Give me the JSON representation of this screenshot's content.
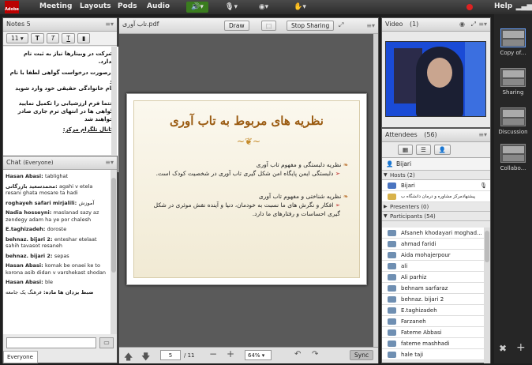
{
  "topbar": {
    "logo": "Adobe",
    "menus": [
      "Meeting",
      "Layouts",
      "Pods",
      "Audio"
    ],
    "help": "Help"
  },
  "notes": {
    "title": "Notes",
    "count": "5",
    "fontsize": "11",
    "lines": [
      "شرکت در وبینارها نیاز به ثبت نام ندارد.",
      "درصورت درخواست گواهی لطفا با نام و",
      "نام خانوادگی حقیقی خود وارد شوید",
      "حتما فرم ارزشیابی را تکمیل نمایید",
      "گواهی ها در انتهای ترم جاری صادر خواهند شد",
      "کانال تلگرام مرکز:"
    ]
  },
  "chat": {
    "title": "Chat",
    "scope": "(Everyone)",
    "footer": "Everyone",
    "messages": [
      {
        "who": "Hasan Abasi",
        "text": "tablighat"
      },
      {
        "who": "محمدسعید بازرگانی",
        "text": "agahi v etela resani ghata mosare ta hadi"
      },
      {
        "who": "roghayeh safari mirjalili",
        "text": "آموزش"
      },
      {
        "who": "Nadia hosseyni",
        "text": "maslanad sazy az zendegy adam ha ye por chalesh"
      },
      {
        "who": "E.taghizadeh",
        "text": "doroste"
      },
      {
        "who": "behnaz. bijari 2",
        "text": "enteshar etelaat sahih tavasot resaneh"
      },
      {
        "who": "behnaz. bijari 2",
        "text": "sepas"
      },
      {
        "who": "Hasan Abasi",
        "text": "komak be onaei ke to korona asib didan v varshekast shodan"
      },
      {
        "who": "Hasan Abasi",
        "text": "ble"
      },
      {
        "who": "ضبط یزدان ها ماده",
        "text": "فرهنگ یک جامعه"
      }
    ]
  },
  "share": {
    "filename": "تاب آوری.pdf",
    "draw": "Draw",
    "stop": "Stop Sharing",
    "page": "5",
    "total": "/ 11",
    "zoom": "64%",
    "sync": "Sync",
    "slide": {
      "title": "نظریه های مربوط به تاب آوری",
      "h1": "نظریه دلبستگی و مفهوم تاب آوری",
      "p1": "دلبستگی ایمن پایگاه امن شکل گیری تاب آوری در شخصیت کودک است.",
      "h2": "نظریه شناختی و مفهوم تاب آوری",
      "p2": "افکار و نگرش های ما نسبت به خودمان، دنیا و آینده نقش موثری در شکل گیری احساسات و رفتارهای ما دارد."
    }
  },
  "video": {
    "title": "Video",
    "count": "(1)"
  },
  "attendees": {
    "title": "Attendees",
    "count": "(56)",
    "me": "Bijari",
    "hosts_label": "Hosts (2)",
    "hosts": [
      "Bijari",
      "پیشنهادمرکز مشاوره و درمان دانشگاه ب"
    ],
    "presenters_label": "Presenters (0)",
    "participants_label": "Participants (54)",
    "participants": [
      "Afsaneh khodayari moghad...",
      "ahmad faridi",
      "Aida mohajerpour",
      "ali",
      "Ali parhiz",
      "behnam sarfaraz",
      "behnaz. bijari 2",
      "E.taghizadeh",
      "Farzaneh",
      "Fateme Abbasi",
      "fateme mashhadi",
      "hale taji"
    ]
  },
  "rail": {
    "items": [
      "Copy of...",
      "Sharing",
      "Discussion",
      "Collabo..."
    ]
  },
  "colors": {
    "topbar": "#2c2c2c",
    "accent": "#3a7d1e",
    "slide_title": "#9a5a10",
    "pod_bg": "#e9e9e9"
  }
}
